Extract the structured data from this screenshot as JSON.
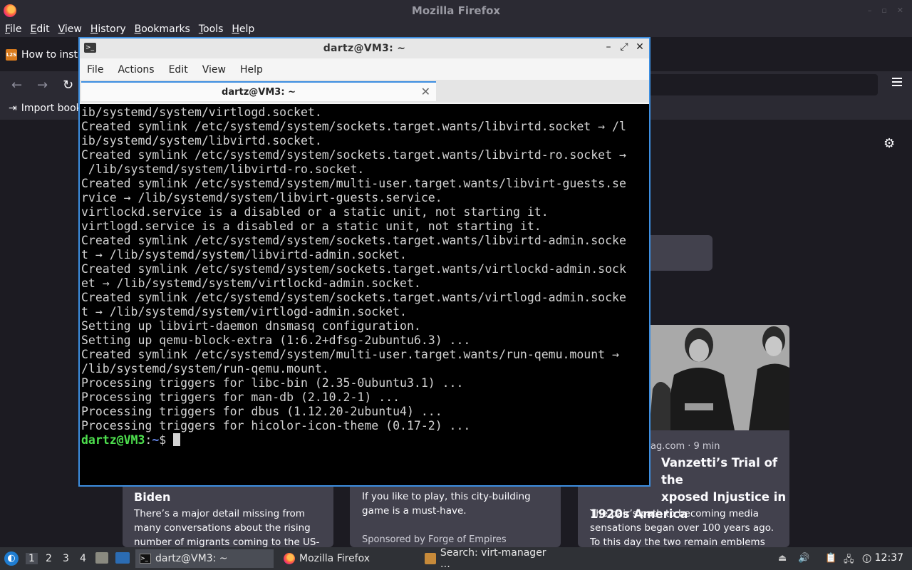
{
  "firefox": {
    "window_title": "Mozilla Firefox",
    "menu": [
      "File",
      "Edit",
      "View",
      "History",
      "Bookmarks",
      "Tools",
      "Help"
    ],
    "tab_title": "How to insta",
    "tab_favicon": "L2S",
    "bookmarks_import": "Import book",
    "cards": [
      {
        "headline": "Biden",
        "excerpt": "There’s a major detail missing from many conversations about the rising number of migrants coming to the US-Mexico…"
      },
      {
        "excerpt": "If you like to play, this city-building game is a must-have.",
        "sponsor": "Sponsored by Forge of Empires"
      },
      {
        "source": "ag.com · 9 min",
        "headline": "Vanzetti’s Trial of the xposed Injustice in 1920s America",
        "headline_lines": [
          "Vanzetti’s Trial of the",
          "xposed Injustice in",
          "1920s America"
        ],
        "excerpt": "The pair’s path to becoming media sensations began over 100 years ago. To this day the two remain emblems of…"
      }
    ]
  },
  "terminal": {
    "window_title": "dartz@VM3: ~",
    "menu": [
      "File",
      "Actions",
      "Edit",
      "View",
      "Help"
    ],
    "tab_title": "dartz@VM3: ~",
    "lines": [
      "ib/systemd/system/virtlogd.socket.",
      "Created symlink /etc/systemd/system/sockets.target.wants/libvirtd.socket → /l",
      "ib/systemd/system/libvirtd.socket.",
      "Created symlink /etc/systemd/system/sockets.target.wants/libvirtd-ro.socket →",
      " /lib/systemd/system/libvirtd-ro.socket.",
      "Created symlink /etc/systemd/system/multi-user.target.wants/libvirt-guests.se",
      "rvice → /lib/systemd/system/libvirt-guests.service.",
      "virtlockd.service is a disabled or a static unit, not starting it.",
      "virtlogd.service is a disabled or a static unit, not starting it.",
      "Created symlink /etc/systemd/system/sockets.target.wants/libvirtd-admin.socke",
      "t → /lib/systemd/system/libvirtd-admin.socket.",
      "Created symlink /etc/systemd/system/sockets.target.wants/virtlockd-admin.sock",
      "et → /lib/systemd/system/virtlockd-admin.socket.",
      "Created symlink /etc/systemd/system/sockets.target.wants/virtlogd-admin.socke",
      "t → /lib/systemd/system/virtlogd-admin.socket.",
      "Setting up libvirt-daemon dnsmasq configuration.",
      "Setting up qemu-block-extra (1:6.2+dfsg-2ubuntu6.3) ...",
      "Created symlink /etc/systemd/system/multi-user.target.wants/run-qemu.mount →",
      "/lib/systemd/system/run-qemu.mount.",
      "Processing triggers for libc-bin (2.35-0ubuntu3.1) ...",
      "Processing triggers for man-db (2.10.2-1) ...",
      "Processing triggers for dbus (1.12.20-2ubuntu4) ...",
      "Processing triggers for hicolor-icon-theme (0.17-2) ..."
    ],
    "prompt_user": "dartz@VM3",
    "prompt_sep": ":",
    "prompt_path": "~",
    "prompt_symbol": "$ "
  },
  "taskbar": {
    "workspaces": [
      "1",
      "2",
      "3",
      "4"
    ],
    "tasks": [
      "dartz@VM3: ~",
      "Mozilla Firefox",
      "Search: virt-manager …"
    ],
    "clock": "12:37"
  },
  "colors": {
    "terminal_bg": "#000000",
    "prompt_user": "#4ee04e",
    "prompt_path": "#6a8cf0",
    "accent": "#3d8ee0"
  }
}
